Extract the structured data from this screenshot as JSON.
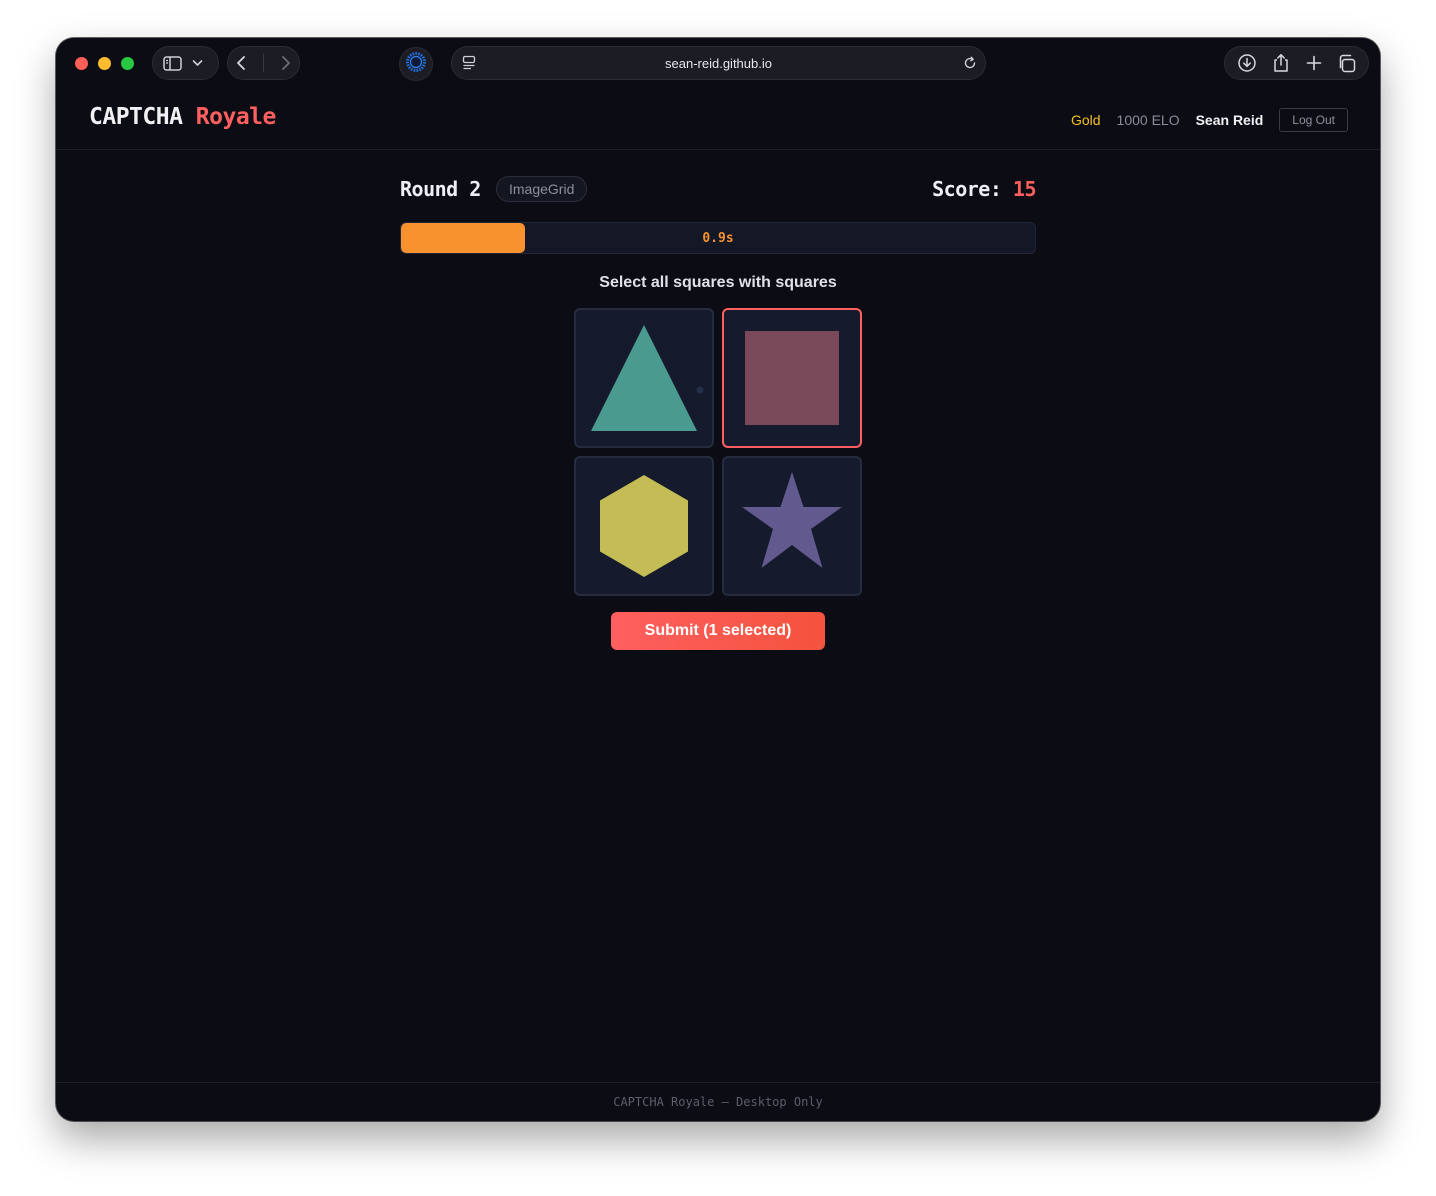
{
  "browser": {
    "url": "sean-reid.github.io"
  },
  "header": {
    "logo_primary": "CAPTCHA",
    "logo_accent": "Royale",
    "rank": "Gold",
    "elo": "1000 ELO",
    "username": "Sean Reid",
    "logout_label": "Log Out"
  },
  "game": {
    "round_label": "Round 2",
    "mode": "ImageGrid",
    "score_label": "Score:",
    "score_value": "15",
    "timer_text": "0.9s",
    "timer_fraction": 0.195,
    "prompt": "Select all squares with squares",
    "tiles": [
      {
        "shape": "triangle-icon",
        "color": "#4a9a90",
        "selected": false
      },
      {
        "shape": "square-icon",
        "color": "#7a4a5a",
        "selected": true
      },
      {
        "shape": "hexagon-icon",
        "color": "#c4bc55",
        "selected": false
      },
      {
        "shape": "star-icon",
        "color": "#625a8e",
        "selected": false
      }
    ],
    "submit_label": "Submit (1 selected)"
  },
  "footer": {
    "text": "CAPTCHA Royale — Desktop Only"
  },
  "colors": {
    "accent": "#ff5f5f",
    "timer": "#f7922e",
    "gold": "#f6c026",
    "background": "#0b0c14"
  }
}
